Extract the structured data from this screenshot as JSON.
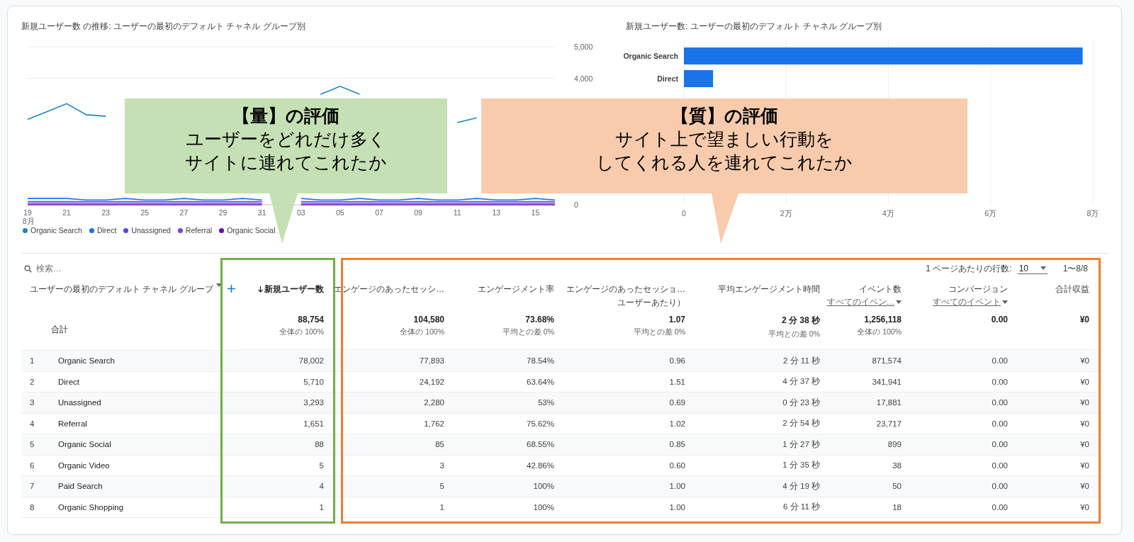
{
  "line_chart": {
    "title": "新規ユーザー数 の推移: ユーザーの最初のデフォルト チャネル グループ別",
    "x_sublabel": "8月",
    "chart_data": {
      "type": "line",
      "categories": [
        "19",
        null,
        "21",
        null,
        "23",
        null,
        "25",
        null,
        "27",
        null,
        "29",
        null,
        "31",
        null,
        "03",
        null,
        "05",
        null,
        "07",
        null,
        "09",
        null,
        "11",
        null,
        "13",
        null,
        "15",
        null
      ],
      "ylim": [
        0,
        5000
      ],
      "yticks": [
        {
          "value": 0,
          "label": "0"
        },
        {
          "value": 4000,
          "label": "4,000"
        },
        {
          "value": 5000,
          "label": "5,000"
        }
      ],
      "series": [
        {
          "name": "Organic Search",
          "color": "#1a84c4",
          "values": [
            2700,
            2950,
            3200,
            2850,
            2800,
            null,
            null,
            null,
            null,
            null,
            null,
            null,
            null,
            null,
            null,
            3500,
            3750,
            3500,
            null,
            null,
            null,
            null,
            2600,
            2750,
            null,
            null,
            null,
            null
          ]
        },
        {
          "name": "Direct",
          "color": "#1a73e8",
          "values": [
            200,
            200,
            200,
            150,
            150,
            200,
            150,
            150,
            200,
            150,
            150,
            200,
            150,
            null,
            200,
            150,
            150,
            200,
            150,
            150,
            200,
            150,
            150,
            200,
            150,
            150,
            200,
            150
          ]
        },
        {
          "name": "Unassigned",
          "color": "#4c4ce6",
          "values": [
            100,
            100,
            100,
            100,
            100,
            100,
            100,
            100,
            100,
            100,
            100,
            100,
            100,
            null,
            100,
            100,
            100,
            100,
            100,
            100,
            100,
            100,
            100,
            100,
            100,
            100,
            100,
            100
          ]
        },
        {
          "name": "Referral",
          "color": "#7b3fe4",
          "values": [
            50,
            50,
            50,
            50,
            50,
            50,
            50,
            50,
            50,
            50,
            50,
            50,
            50,
            null,
            50,
            50,
            50,
            50,
            50,
            50,
            50,
            50,
            50,
            50,
            50,
            50,
            50,
            50
          ]
        },
        {
          "name": "Organic Social",
          "color": "#6a0dad",
          "values": [
            0,
            0,
            0,
            0,
            0,
            0,
            0,
            0,
            0,
            0,
            0,
            0,
            0,
            null,
            0,
            0,
            0,
            0,
            0,
            0,
            0,
            0,
            0,
            0,
            0,
            0,
            0,
            0
          ]
        }
      ]
    }
  },
  "bar_chart": {
    "title": "新規ユーザー数: ユーザーの最初のデフォルト チャネル グループ別",
    "chart_data": {
      "type": "bar",
      "orientation": "horizontal",
      "grid": true,
      "categories": [
        "Organic Search",
        "Direct",
        null,
        null,
        null,
        null,
        null
      ],
      "xlim": [
        0,
        8
      ],
      "xticks": [
        {
          "value": 0,
          "label": "0"
        },
        {
          "value": 2,
          "label": "2万"
        },
        {
          "value": 4,
          "label": "4万"
        },
        {
          "value": 6,
          "label": "6万"
        },
        {
          "value": 8,
          "label": "8万"
        }
      ],
      "series": [
        {
          "color": "#1a73e8",
          "values": [
            7.8,
            0.57,
            null,
            null,
            null,
            null,
            null
          ]
        }
      ]
    }
  },
  "table": {
    "search": {
      "placeholder": "検索…"
    },
    "rows_per_page": {
      "label": "1 ページあたりの行数:",
      "value": "10"
    },
    "range": "1〜8/8",
    "dimension": "ユーザーの最初のデフォルト チャネル グループ",
    "total_label": "合計",
    "columns": [
      {
        "label": "新規ユーザー数",
        "sorted": true,
        "total": "88,754",
        "total_note": "全体の 100%"
      },
      {
        "label": "エンゲージのあったセッシ…",
        "sorted": false,
        "total": "104,580",
        "total_note": "全体の 100%"
      },
      {
        "label": "エンゲージメント率",
        "sorted": false,
        "total": "73.68%",
        "total_note": "平均との差 0%"
      },
      {
        "label": "エンゲージのあったセッショ…",
        "label_2": "ユーザーあたり）",
        "sorted": false,
        "total": "1.07",
        "total_note": "平均との差 0%"
      },
      {
        "label": "平均エンゲージメント時間",
        "sorted": false,
        "total": "2 分 38 秒",
        "total_note": "平均との差 0%"
      },
      {
        "label": "イベント数",
        "filter": "すべてのイベン…",
        "sorted": false,
        "total": "1,256,118",
        "total_note": "全体の 100%"
      },
      {
        "label": "コンバージョン",
        "filter": "すべてのイベント",
        "sorted": false,
        "total": "0.00"
      },
      {
        "label": "合計収益",
        "sorted": false,
        "total": "¥0"
      }
    ],
    "rows": [
      {
        "index": "1",
        "name": "Organic Search",
        "cells": [
          "78,002",
          "77,893",
          "78.54%",
          "0.96",
          "2 分 11 秒",
          "871,574",
          "0.00",
          "¥0"
        ]
      },
      {
        "index": "2",
        "name": "Direct",
        "cells": [
          "5,710",
          "24,192",
          "63.64%",
          "1.51",
          "4 分 37 秒",
          "341,941",
          "0.00",
          "¥0"
        ]
      },
      {
        "index": "3",
        "name": "Unassigned",
        "cells": [
          "3,293",
          "2,280",
          "53%",
          "0.69",
          "0 分 23 秒",
          "17,881",
          "0.00",
          "¥0"
        ]
      },
      {
        "index": "4",
        "name": "Referral",
        "cells": [
          "1,651",
          "1,762",
          "75.62%",
          "1.02",
          "2 分 54 秒",
          "23,717",
          "0.00",
          "¥0"
        ]
      },
      {
        "index": "5",
        "name": "Organic Social",
        "cells": [
          "88",
          "85",
          "68.55%",
          "0.85",
          "1 分 27 秒",
          "899",
          "0.00",
          "¥0"
        ]
      },
      {
        "index": "6",
        "name": "Organic Video",
        "cells": [
          "5",
          "3",
          "42.86%",
          "0.60",
          "1 分 35 秒",
          "38",
          "0.00",
          "¥0"
        ]
      },
      {
        "index": "7",
        "name": "Paid Search",
        "cells": [
          "4",
          "5",
          "100%",
          "1.00",
          "4 分 19 秒",
          "50",
          "0.00",
          "¥0"
        ]
      },
      {
        "index": "8",
        "name": "Organic Shopping",
        "cells": [
          "1",
          "1",
          "100%",
          "1.00",
          "6 分 11 秒",
          "18",
          "0.00",
          "¥0"
        ]
      }
    ]
  },
  "highlights": [
    {
      "color": "#70ad47"
    },
    {
      "color": "#ed7d31"
    }
  ],
  "callouts": [
    {
      "title": "【量】の評価",
      "lines": [
        "ユーザーをどれだけ多く",
        "サイトに連れてこれたか"
      ],
      "color": "#c5e0b4"
    },
    {
      "title": "【質】の評価",
      "lines": [
        "サイト上で望ましい行動を",
        "してくれる人を連れてこれたか"
      ],
      "color": "#f8cbad"
    }
  ]
}
